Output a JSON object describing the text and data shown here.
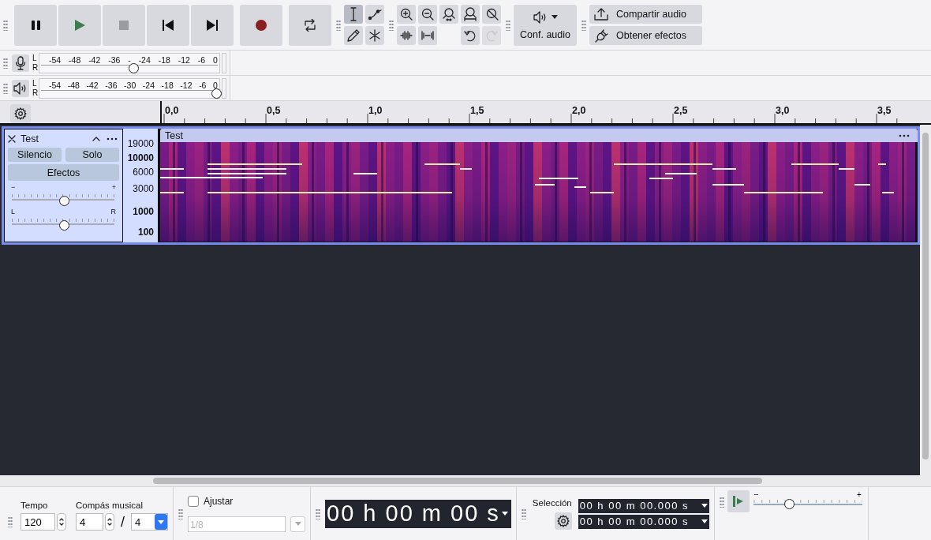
{
  "transport": [
    {
      "kind": "pause"
    },
    {
      "kind": "play"
    },
    {
      "kind": "stop"
    },
    {
      "kind": "skip_start"
    },
    {
      "kind": "skip_end"
    },
    {
      "kind": "record"
    },
    {
      "kind": "loop"
    }
  ],
  "tools": [
    {
      "kind": "select",
      "selected": true
    },
    {
      "kind": "envelope",
      "selected": false
    },
    {
      "kind": "draw",
      "selected": false
    },
    {
      "kind": "multi",
      "selected": false
    }
  ],
  "edit_buttons": [
    {
      "kind": "zoom_in",
      "disabled": false
    },
    {
      "kind": "zoom_out",
      "disabled": false
    },
    {
      "kind": "fit_selection",
      "disabled": false
    },
    {
      "kind": "fit_project",
      "disabled": false
    },
    {
      "kind": "zoom_toggle",
      "disabled": false
    },
    {
      "kind": "trim",
      "disabled": false
    },
    {
      "kind": "silence",
      "disabled": false
    },
    {
      "kind": "undo",
      "disabled": false
    },
    {
      "kind": "redo",
      "disabled": true
    }
  ],
  "audio_setup": {
    "label": "Conf. audio"
  },
  "share_buttons": [
    {
      "kind": "share",
      "label": "Compartir audio"
    },
    {
      "kind": "effects",
      "label": "Obtener efectos"
    }
  ],
  "meters": [
    {
      "kind": "record",
      "channels": [
        "L",
        "R"
      ],
      "scale": [
        "-54",
        "-48",
        "-42",
        "-36",
        "-",
        "-24",
        "-18",
        "-12",
        "-6",
        "0"
      ],
      "level": 0.52
    },
    {
      "kind": "playback",
      "channels": [
        "L",
        "R"
      ],
      "scale": [
        "-54",
        "-48",
        "-42",
        "-36",
        "-30",
        "-24",
        "-18",
        "-12",
        "-6",
        "0"
      ],
      "level": 1.0
    }
  ],
  "ruler": {
    "labels": [
      "0,0",
      "0,5",
      "1,0",
      "1,5",
      "2,0",
      "2,5",
      "3,0",
      "3,5"
    ]
  },
  "track": {
    "name": "Test",
    "buttons": [
      "Silencio",
      "Solo"
    ],
    "effects_button": "Efectos",
    "gain": {
      "minus": "−",
      "plus": "+",
      "level": 0.5
    },
    "pan": {
      "left": "L",
      "right": "R",
      "level": 0.5
    },
    "frequency_scale": [
      {
        "label": "19000",
        "major": false
      },
      {
        "label": "10000",
        "major": true
      },
      {
        "label": "6000",
        "major": false
      },
      {
        "label": "3000",
        "major": false
      },
      {
        "label": "1000",
        "major": true
      },
      {
        "label": "100",
        "major": true
      }
    ],
    "clip_title": "Test"
  },
  "tempo": {
    "label": "Tempo",
    "value": "120"
  },
  "time_signature": {
    "label": "Compás musical",
    "numerator": "4",
    "separator": "/",
    "denominator": "4"
  },
  "snap": {
    "label": "Ajustar",
    "checked": false,
    "value": "1/8",
    "disabled": true
  },
  "time_display": "00 h 00 m 00 s",
  "selection": {
    "label": "Selección",
    "start": "00 h 00 m 00.000 s",
    "end": "00 h 00 m 00.000 s"
  },
  "play_speed": {
    "minus": "−",
    "plus": "+",
    "level": 0.33
  }
}
